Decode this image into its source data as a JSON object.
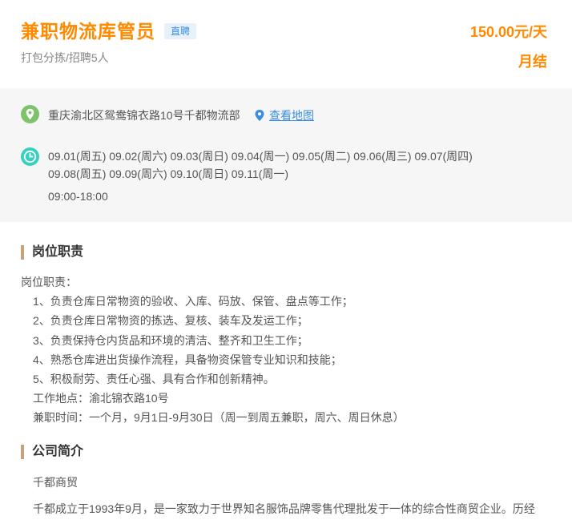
{
  "job": {
    "title": "兼职物流库管员",
    "badge": "直聘",
    "subtitle": "打包分拣/招聘5人",
    "salary": "150.00元/天",
    "settlement": "月结"
  },
  "info": {
    "address": "重庆渝北区鸳鸯锦衣路10号千都物流部",
    "map_link": "查看地图",
    "dates_line1": "09.01(周五) 09.02(周六) 09.03(周日) 09.04(周一) 09.05(周二) 09.06(周三) 09.07(周四)",
    "dates_line2": "09.08(周五) 09.09(周六) 09.10(周日) 09.11(周一)",
    "hours": "09:00-18:00"
  },
  "duties": {
    "heading": "岗位职责",
    "lines": [
      "岗位职责：",
      "1、负责仓库日常物资的验收、入库、码放、保管、盘点等工作；",
      "2、负责仓库日常物资的拣选、复核、装车及发运工作；",
      "3、负责保持仓内货品和环境的清洁、整齐和卫生工作；",
      "4、熟悉仓库进出货操作流程，具备物资保管专业知识和技能；",
      "5、积极耐劳、责任心强、具有合作和创新精神。",
      "工作地点：渝北锦衣路10号",
      "兼职时间：一个月，9月1日-9月30日（周一到周五兼职，周六、周日休息）"
    ]
  },
  "company": {
    "heading": "公司简介",
    "name": "千都商贸",
    "description": "千都成立于1993年9月，是一家致力于世界知名服饰品牌零售代理批发于一体的综合性商贸企业。历经"
  },
  "colors": {
    "accent": "#ff8a00",
    "link": "#3b8de0",
    "location_icon": "#7cc36b",
    "clock_icon": "#35d0c0",
    "section_bar": "#c8a17d"
  },
  "icons": {
    "location": "location-pin-icon",
    "clock": "clock-icon",
    "map_pin": "map-pin-icon"
  }
}
